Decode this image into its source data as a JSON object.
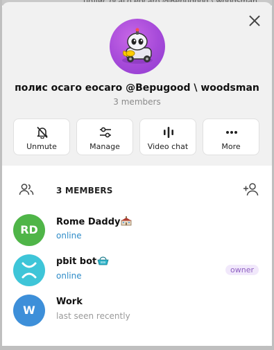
{
  "background": {
    "title_fragment": "полис осаго eocaro @Bepugood \\ woodsman"
  },
  "header": {
    "title": "полис осаго eocaro @Bepugood \\ woodsman",
    "subtitle": "3 members",
    "avatar_icon": "cartoon-robot-car-icon"
  },
  "actions": [
    {
      "label": "Unmute",
      "icon": "bell-off-icon"
    },
    {
      "label": "Manage",
      "icon": "sliders-icon"
    },
    {
      "label": "Video chat",
      "icon": "audio-bars-icon"
    },
    {
      "label": "More",
      "icon": "dots-icon"
    }
  ],
  "members_section": {
    "label": "3 MEMBERS",
    "people_icon": "people-icon",
    "add_icon": "add-user-icon"
  },
  "members": [
    {
      "initials": "RD",
      "name": "Rome Daddy",
      "emoji": "school-building-icon",
      "status": "online",
      "color": "#4fb548"
    },
    {
      "initials": "",
      "name": "pbit bot",
      "emoji": "basket-icon",
      "status": "online",
      "badge": "owner",
      "color": "#3ec5d8",
      "icon": "x-logo-icon"
    },
    {
      "initials": "W",
      "name": "Work",
      "status": "last seen recently",
      "color": "#3d8fd9"
    }
  ],
  "colors": {
    "accent": "#2f8cc8",
    "owner_badge": "#8e5fc1",
    "panel_bg": "#f1f1f1"
  }
}
